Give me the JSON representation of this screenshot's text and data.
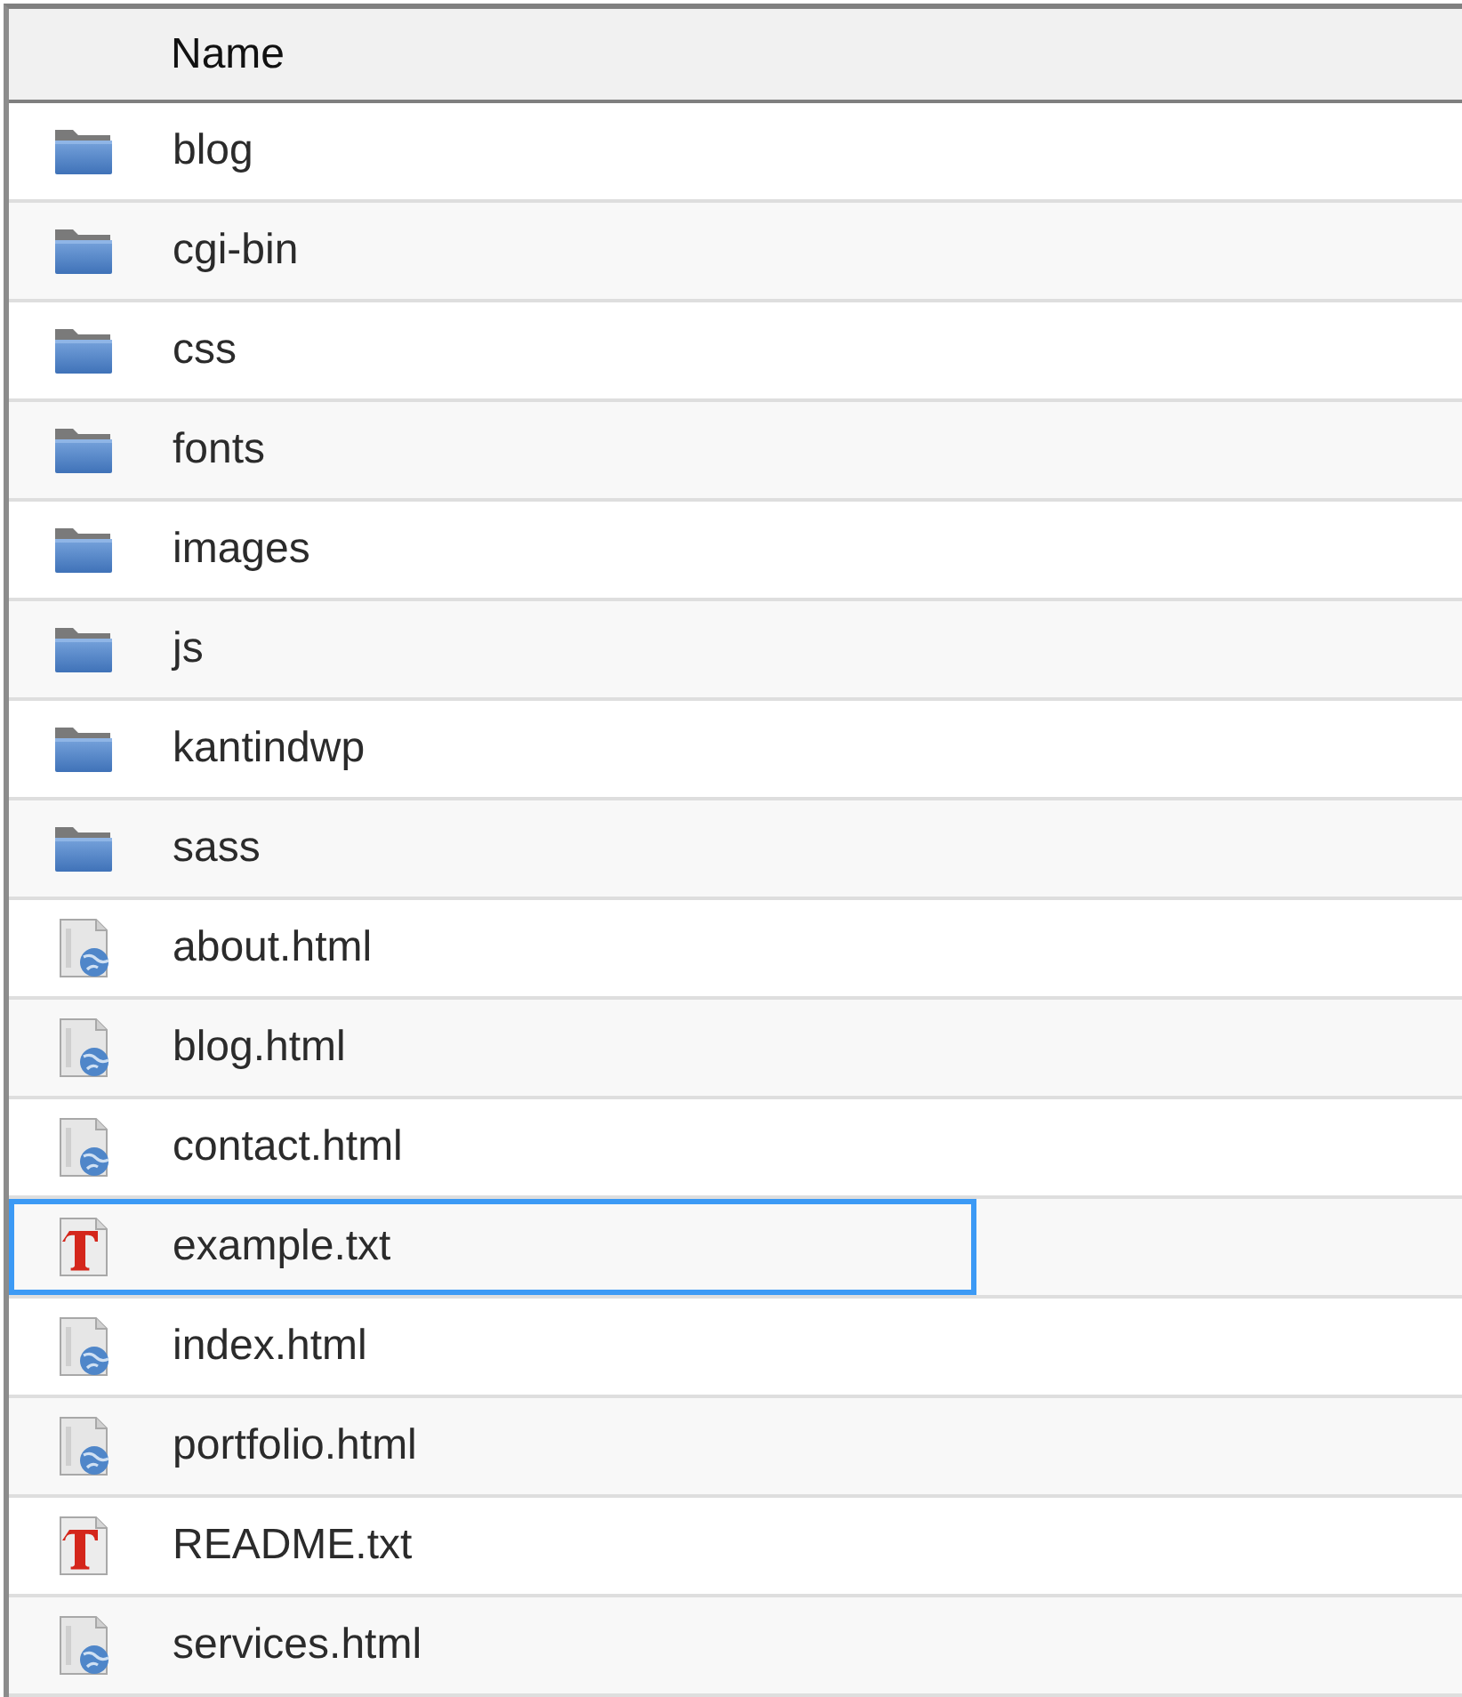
{
  "table": {
    "columns": [
      {
        "label": "Name"
      }
    ],
    "rows": [
      {
        "name": "blog",
        "kind": "folder",
        "selected": false
      },
      {
        "name": "cgi-bin",
        "kind": "folder",
        "selected": false
      },
      {
        "name": "css",
        "kind": "folder",
        "selected": false
      },
      {
        "name": "fonts",
        "kind": "folder",
        "selected": false
      },
      {
        "name": "images",
        "kind": "folder",
        "selected": false
      },
      {
        "name": "js",
        "kind": "folder",
        "selected": false
      },
      {
        "name": "kantindwp",
        "kind": "folder",
        "selected": false
      },
      {
        "name": "sass",
        "kind": "folder",
        "selected": false
      },
      {
        "name": "about.html",
        "kind": "html",
        "selected": false
      },
      {
        "name": "blog.html",
        "kind": "html",
        "selected": false
      },
      {
        "name": "contact.html",
        "kind": "html",
        "selected": false
      },
      {
        "name": "example.txt",
        "kind": "text",
        "selected": true
      },
      {
        "name": "index.html",
        "kind": "html",
        "selected": false
      },
      {
        "name": "portfolio.html",
        "kind": "html",
        "selected": false
      },
      {
        "name": "README.txt",
        "kind": "text",
        "selected": false
      },
      {
        "name": "services.html",
        "kind": "html",
        "selected": false
      }
    ]
  }
}
